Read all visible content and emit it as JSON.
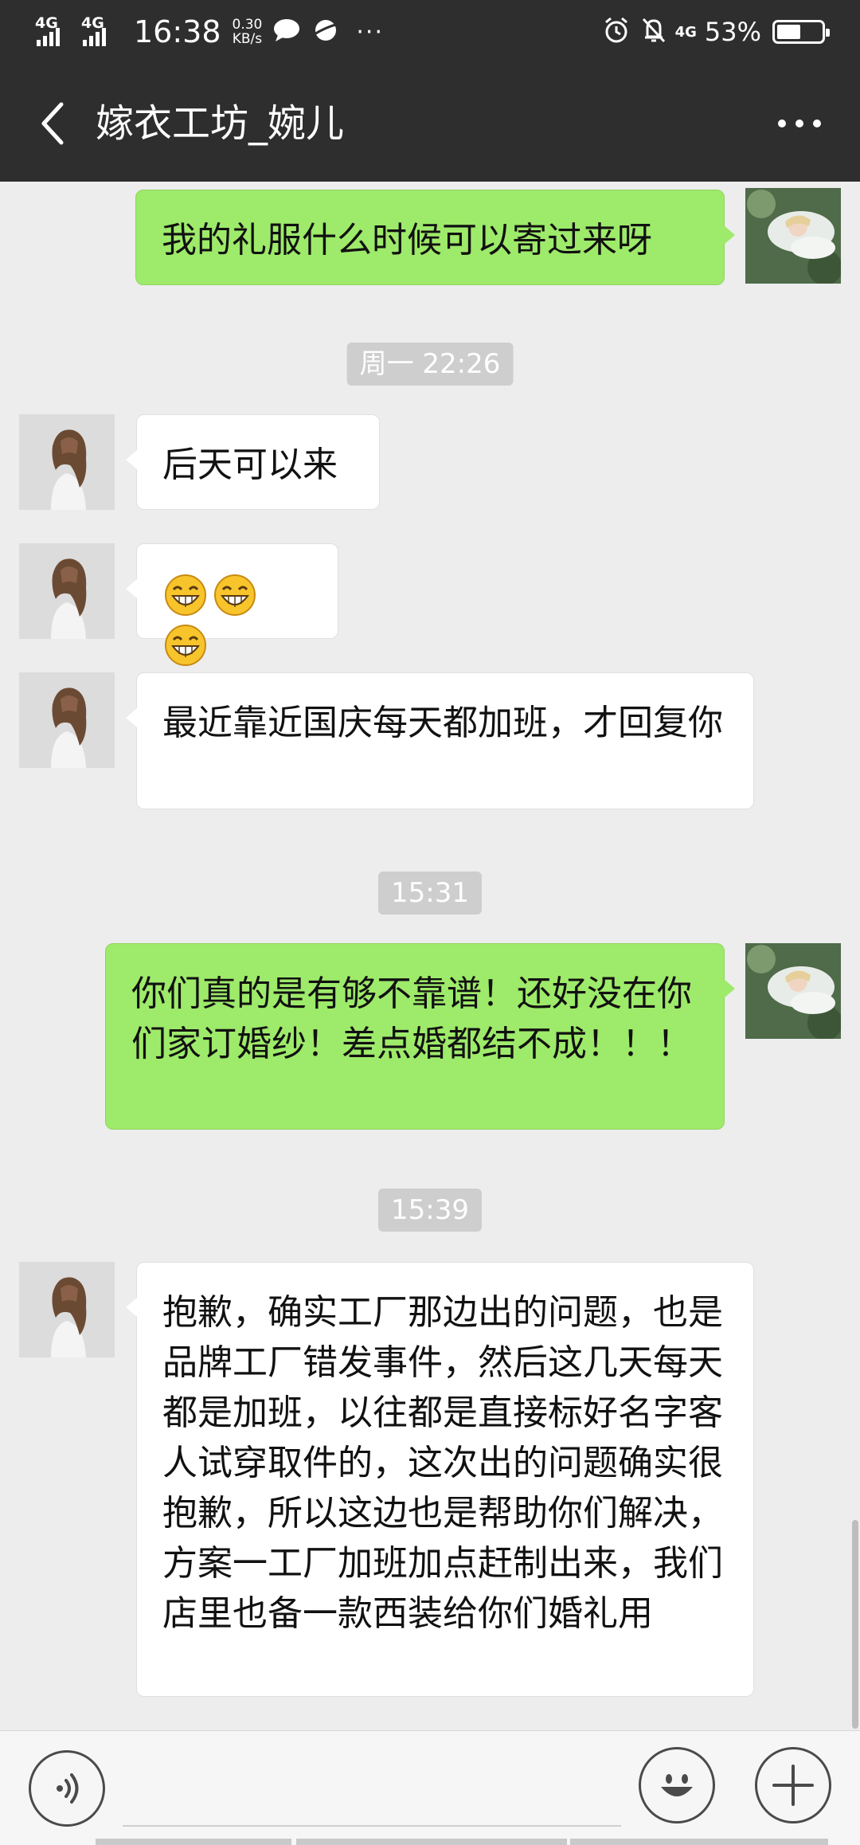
{
  "status_bar": {
    "network_1": "4G",
    "network_2": "4G",
    "time": "16:38",
    "speed_value": "0.30",
    "speed_unit": "KB/s",
    "more": "···",
    "network_3": "4G",
    "battery_percent": "53%",
    "battery_level": 0.53
  },
  "header": {
    "title": "嫁衣工坊_婉儿"
  },
  "messages": [
    {
      "side": "out",
      "text": "我的礼服什么时候可以寄过来呀"
    },
    {
      "side": "timestamp",
      "text": "周一 22:26"
    },
    {
      "side": "in",
      "text": "后天可以来"
    },
    {
      "side": "in",
      "emoji": [
        "grin-emoji",
        "grin-emoji",
        "grin-emoji"
      ]
    },
    {
      "side": "in",
      "text": "最近靠近国庆每天都加班，才回复你"
    },
    {
      "side": "timestamp",
      "text": "15:31"
    },
    {
      "side": "out",
      "text": "你们真的是有够不靠谱！还好没在你们家订婚纱！差点婚都结不成！！！"
    },
    {
      "side": "timestamp",
      "text": "15:39"
    },
    {
      "side": "in",
      "text": "抱歉，确实工厂那边出的问题，也是品牌工厂错发事件，然后这几天每天都是加班，以往都是直接标好名字客人试穿取件的，这次出的问题确实很抱歉，所以这边也是帮助你们解决，方案一工厂加班加点赶制出来，我们店里也备一款西装给你们婚礼用"
    }
  ],
  "input_bar": {
    "voice_icon": "voice-icon",
    "emoji_icon": "smiley-icon",
    "plus_icon": "plus-icon"
  },
  "colors": {
    "header_bg": "#2e2e2e",
    "chat_bg": "#ededed",
    "out_bubble": "#9eea6a",
    "in_bubble": "#ffffff",
    "timestamp_bg": "#cecece"
  }
}
